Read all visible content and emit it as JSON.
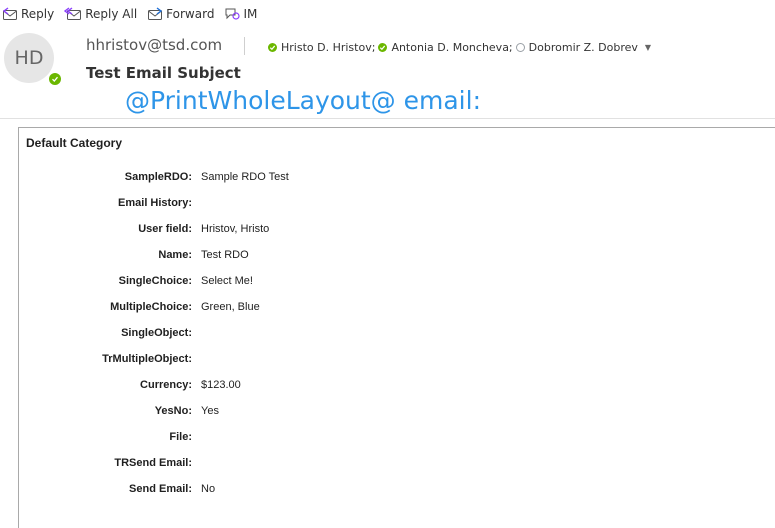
{
  "toolbar": {
    "reply_label": "Reply",
    "reply_all_label": "Reply All",
    "forward_label": "Forward",
    "im_label": "IM"
  },
  "header": {
    "avatar_initials": "HD",
    "sender": "hhristov@tsd.com",
    "subject": "Test Email Subject",
    "recipients": [
      {
        "name": "Hristo D. Hristov;",
        "status": "online"
      },
      {
        "name": "Antonia D. Moncheva;",
        "status": "online"
      },
      {
        "name": "Dobromir Z. Dobrev",
        "status": "offline"
      }
    ]
  },
  "body": {
    "banner": "@PrintWholeLayout@ email:",
    "category_title": "Default Category",
    "fields": [
      {
        "label": "SampleRDO:",
        "value": "Sample RDO Test"
      },
      {
        "label": "Email History:",
        "value": ""
      },
      {
        "label": "User field:",
        "value": "Hristov, Hristo"
      },
      {
        "label": "Name:",
        "value": "Test RDO"
      },
      {
        "label": "SingleChoice:",
        "value": "Select Me!"
      },
      {
        "label": "MultipleChoice:",
        "value": "Green, Blue"
      },
      {
        "label": "SingleObject:",
        "value": ""
      },
      {
        "label": "TrMultipleObject:",
        "value": ""
      },
      {
        "label": "Currency:",
        "value": "$123.00"
      },
      {
        "label": "YesNo:",
        "value": "Yes"
      },
      {
        "label": "File:",
        "value": ""
      },
      {
        "label": "TRSend Email:",
        "value": ""
      },
      {
        "label": "Send Email:",
        "value": "No"
      }
    ]
  },
  "colors": {
    "banner": "#2e95e8",
    "presence_online": "#6bb700",
    "icon_purple": "#8a3ffc"
  }
}
